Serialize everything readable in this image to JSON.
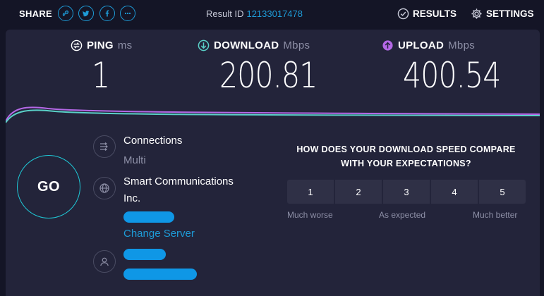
{
  "header": {
    "share_label": "SHARE",
    "share_icons": [
      "link-icon",
      "twitter-icon",
      "facebook-icon",
      "more-icon"
    ],
    "result_id_label": "Result ID",
    "result_id_value": "12133017478",
    "results_label": "RESULTS",
    "settings_label": "SETTINGS"
  },
  "metrics": {
    "ping": {
      "label": "PING",
      "unit": "ms",
      "value": "1"
    },
    "download": {
      "label": "DOWNLOAD",
      "unit": "Mbps",
      "value": "200.81"
    },
    "upload": {
      "label": "UPLOAD",
      "unit": "Mbps",
      "value": "400.54"
    }
  },
  "go_label": "GO",
  "connection": {
    "title": "Connections",
    "mode": "Multi"
  },
  "provider": {
    "name_line1": "Smart Communications",
    "name_line2": "Inc.",
    "change_server": "Change Server"
  },
  "rating": {
    "question_line1": "HOW DOES YOUR DOWNLOAD SPEED COMPARE",
    "question_line2": "WITH YOUR EXPECTATIONS?",
    "options": [
      "1",
      "2",
      "3",
      "4",
      "5"
    ],
    "low_label": "Much worse",
    "mid_label": "As expected",
    "high_label": "Much better"
  },
  "colors": {
    "accent": "#1e9bd7",
    "download": "#5ad1c8",
    "upload": "#b468e6",
    "go_ring": "#1fc8d6",
    "redaction": "#0f97e6"
  }
}
